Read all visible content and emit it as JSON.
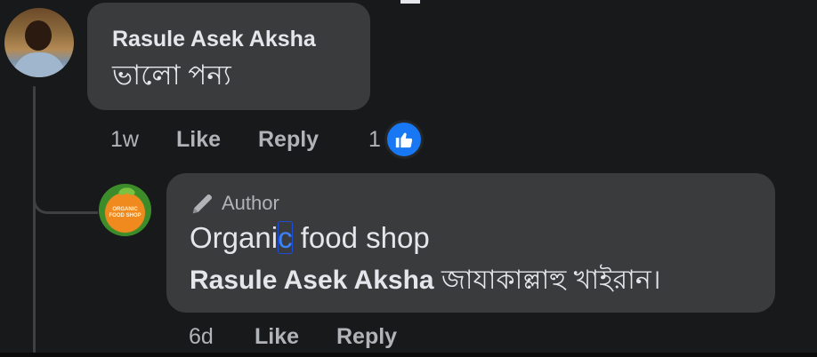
{
  "comment": {
    "author_name": "Rasule Asek Aksha",
    "text": "ভালো পন্য",
    "time": "1w",
    "like_label": "Like",
    "reply_label": "Reply",
    "reaction_count": "1",
    "reaction_icon": "thumbs-up-icon"
  },
  "reply": {
    "author_badge": "Author",
    "page_name": "Organic food shop",
    "mention": "Rasule Asek Aksha",
    "text": "জাযাকাল্লাহু খাইরান।",
    "time": "6d",
    "like_label": "Like",
    "reply_label": "Reply",
    "avatar_logo_text": "ORGANIC FOOD SHOP"
  },
  "colors": {
    "background": "#18191a",
    "bubble": "#3a3b3c",
    "text_primary": "#e4e6eb",
    "text_secondary": "#b0b3b8",
    "reaction_blue": "#1877f2"
  }
}
